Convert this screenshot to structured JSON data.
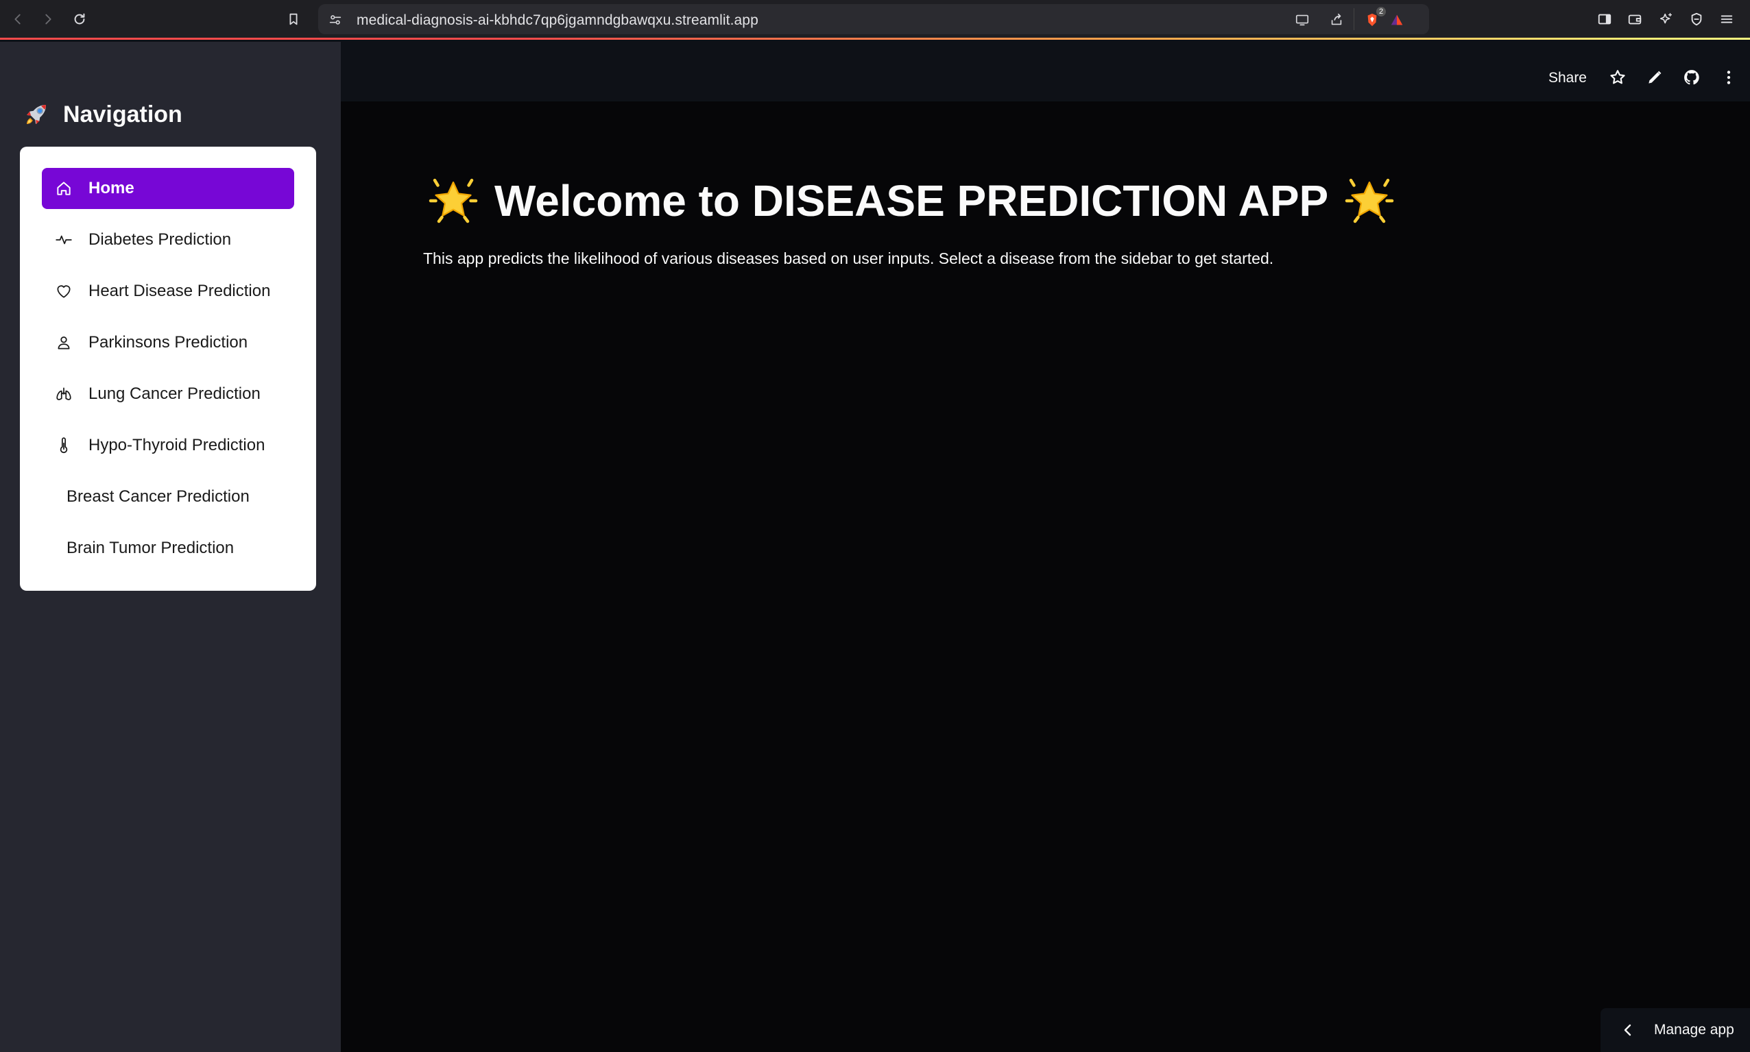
{
  "browser": {
    "url": "medical-diagnosis-ai-kbhdc7qp6jgamndgbawqxu.streamlit.app",
    "brave_badge_count": "2"
  },
  "sidebar": {
    "title": "Navigation",
    "title_icon": "rocket-icon",
    "items": [
      {
        "label": "Home",
        "icon": "home-icon",
        "active": true
      },
      {
        "label": "Diabetes Prediction",
        "icon": "activity-icon"
      },
      {
        "label": "Heart Disease Prediction",
        "icon": "heart-icon"
      },
      {
        "label": "Parkinsons Prediction",
        "icon": "person-icon"
      },
      {
        "label": "Lung Cancer Prediction",
        "icon": "lungs-icon"
      },
      {
        "label": "Hypo-Thyroid Prediction",
        "icon": "thermometer-icon"
      },
      {
        "label": "Breast Cancer Prediction",
        "icon": ""
      },
      {
        "label": "Brain Tumor Prediction",
        "icon": ""
      }
    ]
  },
  "header": {
    "share_label": "Share"
  },
  "main": {
    "title": "Welcome to DISEASE PREDICTION APP",
    "title_icon": "glowing-star-icon",
    "intro": "This app predicts the likelihood of various diseases based on user inputs. Select a disease from the sidebar to get started."
  },
  "footer": {
    "manage_app_label": "Manage app"
  },
  "colors": {
    "accent": "#7707d6",
    "sidebar_bg": "#262730",
    "main_bg": "#060608",
    "header_bg": "#0e1117",
    "text": "#fafafa"
  }
}
